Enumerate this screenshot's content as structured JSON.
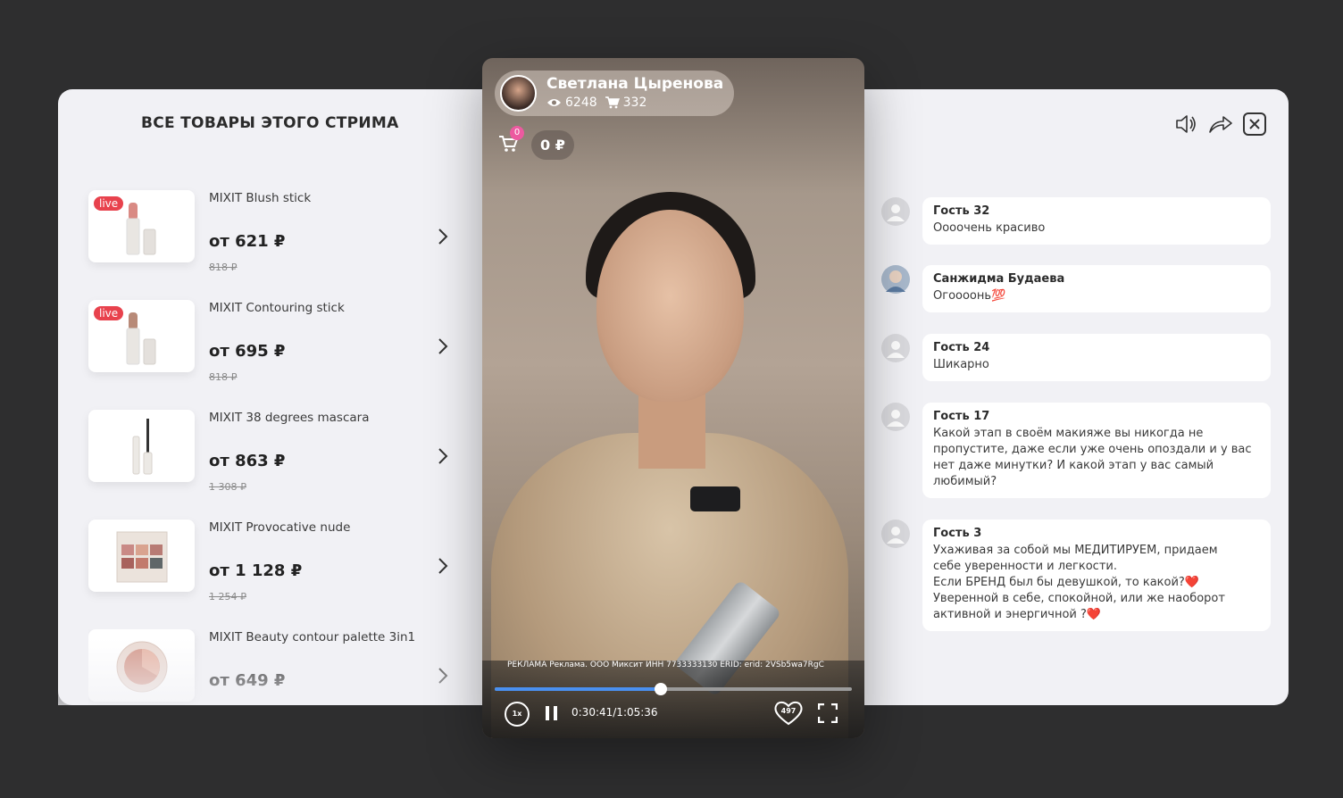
{
  "products_panel": {
    "title": "ВСЕ ТОВАРЫ ЭТОГО СТРИМА",
    "items": [
      {
        "name": "MIXIT Blush stick",
        "price": "от 621 ₽",
        "old_price": "818 ₽",
        "live": true,
        "live_label": "live"
      },
      {
        "name": "MIXIT Contouring stick",
        "price": "от 695 ₽",
        "old_price": "818 ₽",
        "live": true,
        "live_label": "live"
      },
      {
        "name": "MIXIT 38 degrees mascara",
        "price": "от 863 ₽",
        "old_price": "1 308 ₽",
        "live": false
      },
      {
        "name": "MIXIT Provocative nude",
        "price": "от 1 128 ₽",
        "old_price": "1 254 ₽",
        "live": false
      },
      {
        "name": "MIXIT Beauty contour palette 3in1",
        "price": "от 649 ₽",
        "old_price": "",
        "live": false
      }
    ]
  },
  "video": {
    "streamer_name": "Светлана Цыренова",
    "viewers": "6248",
    "purchases": "332",
    "cart_count": "0",
    "cart_total": "0 ₽",
    "ad_text": "РЕКЛАМА Реклама. ООО Миксит ИНН 7733333130 ERID: erid: 2VSb5wa7RgC",
    "progress": 0.465,
    "speed": "1x",
    "time": "0:30:41/1:05:36",
    "likes": "497"
  },
  "chat": {
    "messages": [
      {
        "author": "Гость 32",
        "text": "Оооочень красиво"
      },
      {
        "author": "Санжидма Будаева",
        "text": "Огоооонь💯"
      },
      {
        "author": "Гость 24",
        "text": "Шикарно"
      },
      {
        "author": "Гость 17",
        "text": "Какой этап в своём макияже вы никогда не\nпропустите, даже если уже очень опоздали и у вас\nнет даже минутки? И какой этап у вас самый\nлюбимый?"
      },
      {
        "author": "Гость 3",
        "text": "Ухаживая за собой мы МЕДИТИРУЕМ, придаем\nсебе уверенности и легкости.\nЕсли БРЕНД был бы девушкой, то какой?❤️\nУверенной в себе, спокойной, или же наоборот\nактивной и энергичной ?❤️"
      }
    ]
  },
  "icons": {
    "volume": "volume-icon",
    "share": "share-icon",
    "close": "close-icon"
  },
  "colors": {
    "live_badge": "#e8424d",
    "progress": "#4a90f0",
    "cart_badge": "#ec5aa0"
  }
}
